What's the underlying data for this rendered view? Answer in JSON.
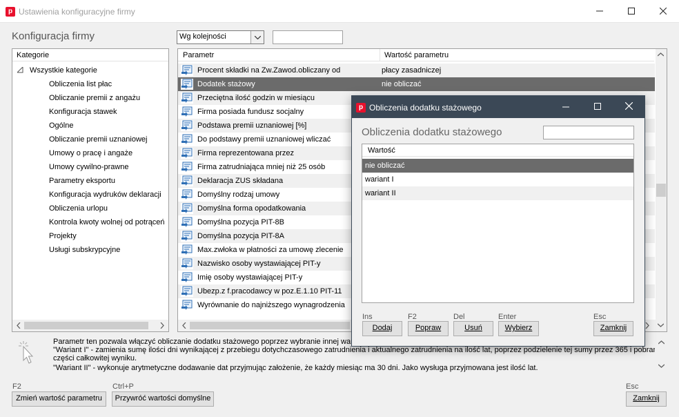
{
  "window": {
    "title": "Ustawienia konfiguracyjne firmy",
    "icon_letter": "p",
    "icon_color": "#e8112d"
  },
  "header": {
    "title": "Konfiguracja firmy",
    "sort_select": "Wg kolejności",
    "search_value": ""
  },
  "categories": {
    "header": "Kategorie",
    "root": "Wszystkie kategorie",
    "items": [
      "Obliczenia list płac",
      "Obliczanie premii z angażu",
      "Konfiguracja stawek",
      "Ogólne",
      "Obliczanie premii uznaniowej",
      "Umowy o pracę i angaże",
      "Umowy cywilno-prawne",
      "Parametry eksportu",
      "Konfiguracja wydruków deklaracji",
      "Obliczenia urlopu",
      "Kontrola kwoty wolnej od potrąceń",
      "Projekty",
      "Usługi subskrypcyjne"
    ]
  },
  "params": {
    "col_param": "Parametr",
    "col_value": "Wartość parametru",
    "rows": [
      {
        "name": "Procent składki na Zw.Zawod.obliczany od",
        "value": "płacy zasadniczej"
      },
      {
        "name": "Dodatek stażowy",
        "value": "nie obliczać"
      },
      {
        "name": "Przeciętna ilość godzin w miesiącu",
        "value": ""
      },
      {
        "name": "Firma posiada fundusz socjalny",
        "value": ""
      },
      {
        "name": "Podstawa premii uznaniowej [%]",
        "value": ""
      },
      {
        "name": "Do podstawy premii uznaniowej wliczać",
        "value": ""
      },
      {
        "name": "Firma reprezentowana przez",
        "value": ""
      },
      {
        "name": "Firma zatrudniająca mniej niż 25 osób",
        "value": ""
      },
      {
        "name": "Deklaracja ZUS składana",
        "value": ""
      },
      {
        "name": "Domyślny rodzaj umowy",
        "value": ""
      },
      {
        "name": "Domyślna forma opodatkowania",
        "value": ""
      },
      {
        "name": "Domyślna pozycja PIT-8B",
        "value": ""
      },
      {
        "name": "Domyślna pozycja PIT-8A",
        "value": ""
      },
      {
        "name": "Max.zwłoka w płatności za umowę zlecenie",
        "value": ""
      },
      {
        "name": "Nazwisko osoby wystawiającej PIT-y",
        "value": ""
      },
      {
        "name": "Imię osoby wystawiającej PIT-y",
        "value": ""
      },
      {
        "name": "Ubezp.z f.pracodawcy w poz.E.1.10 PIT-11",
        "value": ""
      },
      {
        "name": "Wyrównanie do najniższego wynagrodzenia",
        "value": ""
      }
    ]
  },
  "description": {
    "line1": "Parametr ten pozwala włączyć obliczanie dodatku stażowego poprzez wybranie innej warto",
    "line2": "\"Wariant I\" - zamienia sumę ilości dni wynikającej z przebiegu dotychczasowego zatrudnienia i aktualnego zatrudnienia na ilość lat, poprzez podzielenie tej sumy przez 365 i pobranie",
    "line3": "części całkowitej wyniku.",
    "line4": "\"Wariant II\" - wykonuje arytmetyczne dodawanie dat przyjmując założenie, że każdy miesiąc ma 30 dni. Jako wysługa przyjmowana jest ilość lat."
  },
  "footer": {
    "change_key": "F2",
    "change_label": "Zmień wartość parametru",
    "restore_key": "Ctrl+P",
    "restore_label": "Przywróć wartości domyślne",
    "close_key": "Esc",
    "close_label": "Zamknij"
  },
  "dialog": {
    "title": "Obliczenia dodatku stażowego",
    "heading": "Obliczenia dodatku stażowego",
    "search_value": "",
    "col_header": "Wartość",
    "options": [
      "nie obliczać",
      "wariant I",
      "wariant II"
    ],
    "selected_index": 0,
    "buttons": {
      "add_key": "Ins",
      "add_label": "Dodaj",
      "edit_key": "F2",
      "edit_label": "Popraw",
      "delete_key": "Del",
      "delete_label": "Usuń",
      "select_key": "Enter",
      "select_label": "Wybierz",
      "close_key": "Esc",
      "close_label": "Zamknij"
    }
  },
  "colors": {
    "selection": "#6b6b6b",
    "dialog_titlebar": "#3b4856"
  }
}
